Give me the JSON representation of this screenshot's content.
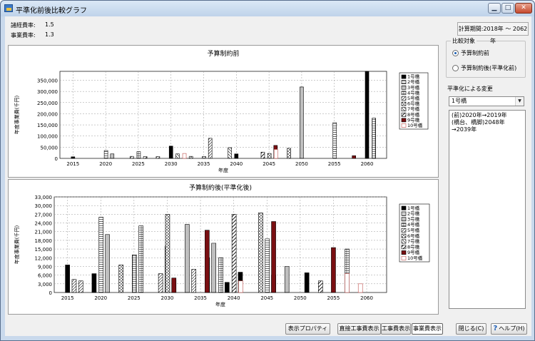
{
  "window": {
    "title": "平準化前後比較グラフ",
    "min_label": "▁",
    "max_label": "□",
    "close_label": "✕"
  },
  "params": {
    "inflation_label": "諸経費率:",
    "inflation_value": "1.5",
    "business_label": "事業費率:",
    "business_value": "1.3",
    "period_label": "計算期間:2018年 〜 2062年"
  },
  "legend": [
    "1号橋",
    "2号橋",
    "3号橋",
    "4号橋",
    "5号橋",
    "6号橋",
    "7号橋",
    "8号橋",
    "9号橋",
    "10号橋"
  ],
  "colors": {
    "accent_red": "#7a0f12",
    "black": "#000000"
  },
  "chart_top": {
    "title": "予算制約前",
    "xlabel": "年度",
    "ylabel": "年度事業費(千円)",
    "xticks": [
      "2015",
      "2020",
      "2025",
      "2030",
      "2035",
      "2040",
      "2045",
      "2050",
      "2055",
      "2060"
    ],
    "yticks": [
      "0",
      "50,000",
      "100,000",
      "150,000",
      "200,000",
      "250,000",
      "300,000",
      "350,000"
    ]
  },
  "chart_bottom": {
    "title": "予算制約後(平準化後)",
    "xlabel": "年度",
    "ylabel": "年度事業費(千円)",
    "xticks": [
      "2015",
      "2020",
      "2025",
      "2030",
      "2035",
      "2040",
      "2045",
      "2050",
      "2055",
      "2060"
    ],
    "yticks": [
      "0",
      "3,000",
      "6,000",
      "9,000",
      "12,000",
      "15,000",
      "18,000",
      "21,000",
      "24,000",
      "27,000",
      "30,000",
      "33,000"
    ]
  },
  "chart_data": [
    {
      "type": "bar",
      "title": "予算制約前",
      "xlabel": "年度",
      "ylabel": "年度事業費(千円)",
      "ylim": [
        0,
        390000
      ],
      "xlim": [
        2013,
        2063
      ],
      "grid": true,
      "legend_position": "right",
      "series": [
        {
          "name": "1号橋",
          "points": [
            [
              2015,
              7000
            ],
            [
              2030,
              55000
            ],
            [
              2040,
              20000
            ],
            [
              2060,
              390000
            ]
          ]
        },
        {
          "name": "2号橋",
          "points": [
            [
              2020,
              35000
            ],
            [
              2055,
              160000
            ]
          ]
        },
        {
          "name": "3号橋",
          "points": [
            [
              2021,
              20000
            ],
            [
              2050,
              320000
            ]
          ]
        },
        {
          "name": "4号橋",
          "points": [
            [
              2025,
              30000
            ],
            [
              2061,
              180000
            ]
          ]
        },
        {
          "name": "5号橋",
          "points": [
            [
              2024,
              9000
            ],
            [
              2028,
              8000
            ],
            [
              2036,
              90000
            ]
          ]
        },
        {
          "name": "6号橋",
          "points": [
            [
              2033,
              9000
            ],
            [
              2035,
              8000
            ],
            [
              2045,
              22000
            ],
            [
              2048,
              45000
            ]
          ]
        },
        {
          "name": "7号橋",
          "points": [
            [
              2031,
              20000
            ],
            [
              2039,
              48000
            ]
          ]
        },
        {
          "name": "8号橋",
          "points": [
            [
              2026,
              8000
            ],
            [
              2044,
              28000
            ]
          ]
        },
        {
          "name": "9号橋",
          "points": [
            [
              2046,
              58000
            ],
            [
              2058,
              12000
            ]
          ]
        },
        {
          "name": "10号橋",
          "points": [
            [
              2032,
              22000
            ],
            [
              2046,
              40000
            ]
          ]
        }
      ]
    },
    {
      "type": "bar",
      "title": "予算制約後(平準化後)",
      "xlabel": "年度",
      "ylabel": "年度事業費(千円)",
      "ylim": [
        0,
        33000
      ],
      "xlim": [
        2013,
        2063
      ],
      "grid": true,
      "legend_position": "right",
      "series": [
        {
          "name": "1号橋",
          "points": [
            [
              2015,
              9500
            ],
            [
              2019,
              6500
            ],
            [
              2030,
              16000
            ],
            [
              2039,
              3500
            ],
            [
              2041,
              7000
            ],
            [
              2051,
              6800
            ]
          ]
        },
        {
          "name": "2号橋",
          "points": [
            [
              2020,
              26000
            ],
            [
              2036,
              12000
            ],
            [
              2045,
              18500
            ]
          ]
        },
        {
          "name": "3号橋",
          "points": [
            [
              2021,
              20000
            ],
            [
              2033,
              23500
            ],
            [
              2037,
              17000
            ],
            [
              2048,
              9000
            ]
          ]
        },
        {
          "name": "4号橋",
          "points": [
            [
              2025,
              13000
            ],
            [
              2026,
              23000
            ],
            [
              2038,
              12000
            ],
            [
              2057,
              15000
            ]
          ]
        },
        {
          "name": "5号橋",
          "points": [
            [
              2016,
              4500
            ],
            [
              2017,
              4000
            ],
            [
              2029,
              6500
            ],
            [
              2034,
              8000
            ]
          ]
        },
        {
          "name": "6号橋",
          "points": [
            [
              2023,
              9500
            ],
            [
              2030,
              27000
            ],
            [
              2044,
              27500
            ]
          ]
        },
        {
          "name": "7号橋",
          "points": [
            [
              2031,
              4300
            ],
            [
              2046,
              6000
            ]
          ]
        },
        {
          "name": "8号橋",
          "points": [
            [
              2040,
              27000
            ],
            [
              2053,
              4000
            ]
          ]
        },
        {
          "name": "9号橋",
          "points": [
            [
              2031,
              5000
            ],
            [
              2036,
              21500
            ],
            [
              2046,
              24500
            ],
            [
              2055,
              15500
            ]
          ]
        },
        {
          "name": "10号橋",
          "points": [
            [
              2041,
              4000
            ],
            [
              2057,
              6500
            ],
            [
              2059,
              3000
            ]
          ]
        }
      ]
    }
  ],
  "sidebar": {
    "group_caption": "比較対象",
    "radio_before": "予算制約前",
    "radio_after": "予算制約後(平準化前)",
    "change_label": "平準化による変更",
    "select_value": "1号橋",
    "notes": [
      "(前)2020年→2019年",
      "(橋台、橋脚)2048年→2039年"
    ]
  },
  "buttons": {
    "properties": "表示プロパティ",
    "direct_cost": "直接工事費表示",
    "construction_cost": "工事費表示",
    "business_cost": "事業費表示",
    "close": "閉じる(C)",
    "help": "ヘルプ(H)"
  }
}
